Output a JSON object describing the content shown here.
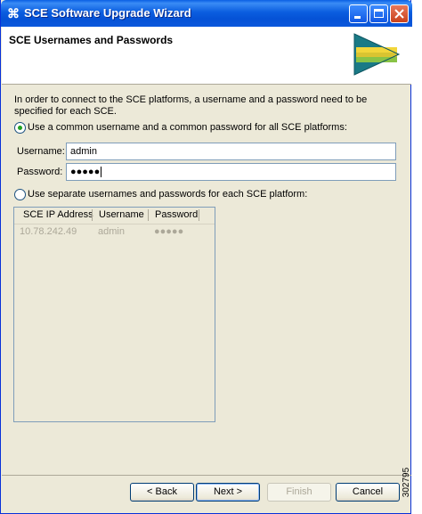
{
  "window": {
    "title": "SCE Software Upgrade Wizard",
    "app_icon": "cisco-icon"
  },
  "header": {
    "title": "SCE Usernames and Passwords",
    "icon": "wizard-arrow-icon"
  },
  "intro_text": "In order to connect to the SCE platforms, a username and a password need to be specified for each SCE.",
  "options": {
    "common": {
      "label": "Use a common username and a common password for all SCE platforms:",
      "selected": true
    },
    "separate": {
      "label": "Use separate usernames and passwords for each SCE platform:",
      "selected": false
    }
  },
  "form": {
    "username_label": "Username:",
    "username_value": "admin",
    "password_label": "Password:",
    "password_value": "●●●●●"
  },
  "table": {
    "columns": [
      "SCE IP Address",
      "Username",
      "Password"
    ],
    "rows": [
      {
        "ip": "10.78.242.49",
        "username": "admin",
        "password": "●●●●●"
      }
    ]
  },
  "buttons": {
    "back": "< Back",
    "next": "Next >",
    "finish": "Finish",
    "cancel": "Cancel"
  },
  "figure_id": "302795"
}
